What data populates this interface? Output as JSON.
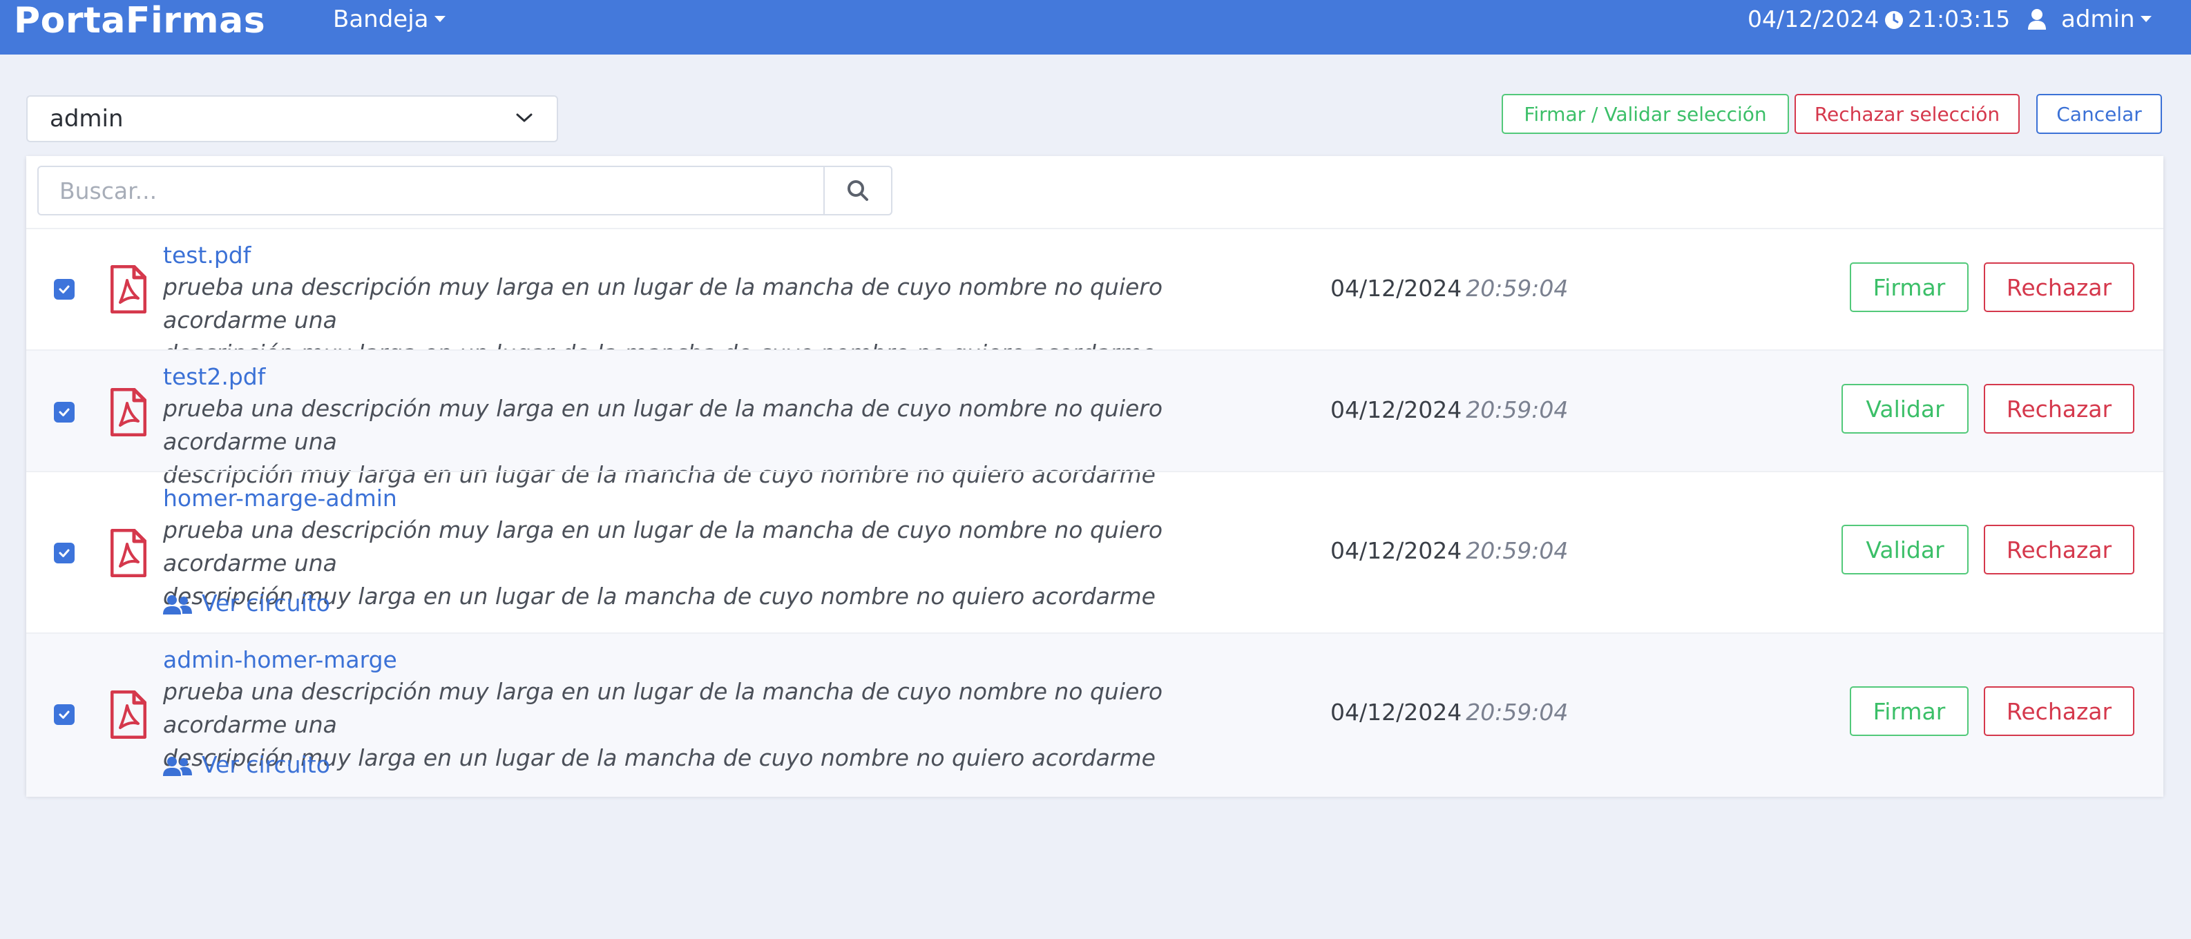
{
  "header": {
    "brand": "PortaFirmas",
    "nav_menu": "Bandeja",
    "date": "04/12/2024",
    "time": "21:03:15",
    "user": "admin"
  },
  "controls": {
    "user_select_value": "admin",
    "sign_validate_selection": "Firmar / Validar selección",
    "reject_selection": "Rechazar selección",
    "cancel": "Cancelar"
  },
  "search": {
    "placeholder": "Buscar...",
    "value": ""
  },
  "documents": [
    {
      "name": "test.pdf",
      "desc1": "prueba una descripción muy larga en un lugar de la mancha de cuyo nombre no quiero acordarme una",
      "desc2": "descripción muy larga en un lugar de la mancha de cuyo nombre no quiero acordarme",
      "date": "04/12/2024",
      "time": "20:59:04",
      "action": "Firmar",
      "reject": "Rechazar",
      "circuit": "",
      "checked": true
    },
    {
      "name": "test2.pdf",
      "desc1": "prueba una descripción muy larga en un lugar de la mancha de cuyo nombre no quiero acordarme una",
      "desc2": "descripción muy larga en un lugar de la mancha de cuyo nombre no quiero acordarme",
      "date": "04/12/2024",
      "time": "20:59:04",
      "action": "Validar",
      "reject": "Rechazar",
      "circuit": "",
      "checked": true
    },
    {
      "name": "homer-marge-admin",
      "desc1": "prueba una descripción muy larga en un lugar de la mancha de cuyo nombre no quiero acordarme una",
      "desc2": "descripción muy larga en un lugar de la mancha de cuyo nombre no quiero acordarme",
      "date": "04/12/2024",
      "time": "20:59:04",
      "action": "Validar",
      "reject": "Rechazar",
      "circuit": "Ver circuito",
      "checked": true
    },
    {
      "name": "admin-homer-marge",
      "desc1": "prueba una descripción muy larga en un lugar de la mancha de cuyo nombre no quiero acordarme una",
      "desc2": "descripción muy larga en un lugar de la mancha de cuyo nombre no quiero acordarme",
      "date": "04/12/2024",
      "time": "20:59:04",
      "action": "Firmar",
      "reject": "Rechazar",
      "circuit": "Ver circuito",
      "checked": true
    }
  ],
  "colors": {
    "header_bg": "#4479db",
    "page_bg": "#edf0f8",
    "link": "#3b71d6",
    "green": "#3bbf68",
    "red": "#d5384c",
    "checkbox": "#3d74db"
  }
}
